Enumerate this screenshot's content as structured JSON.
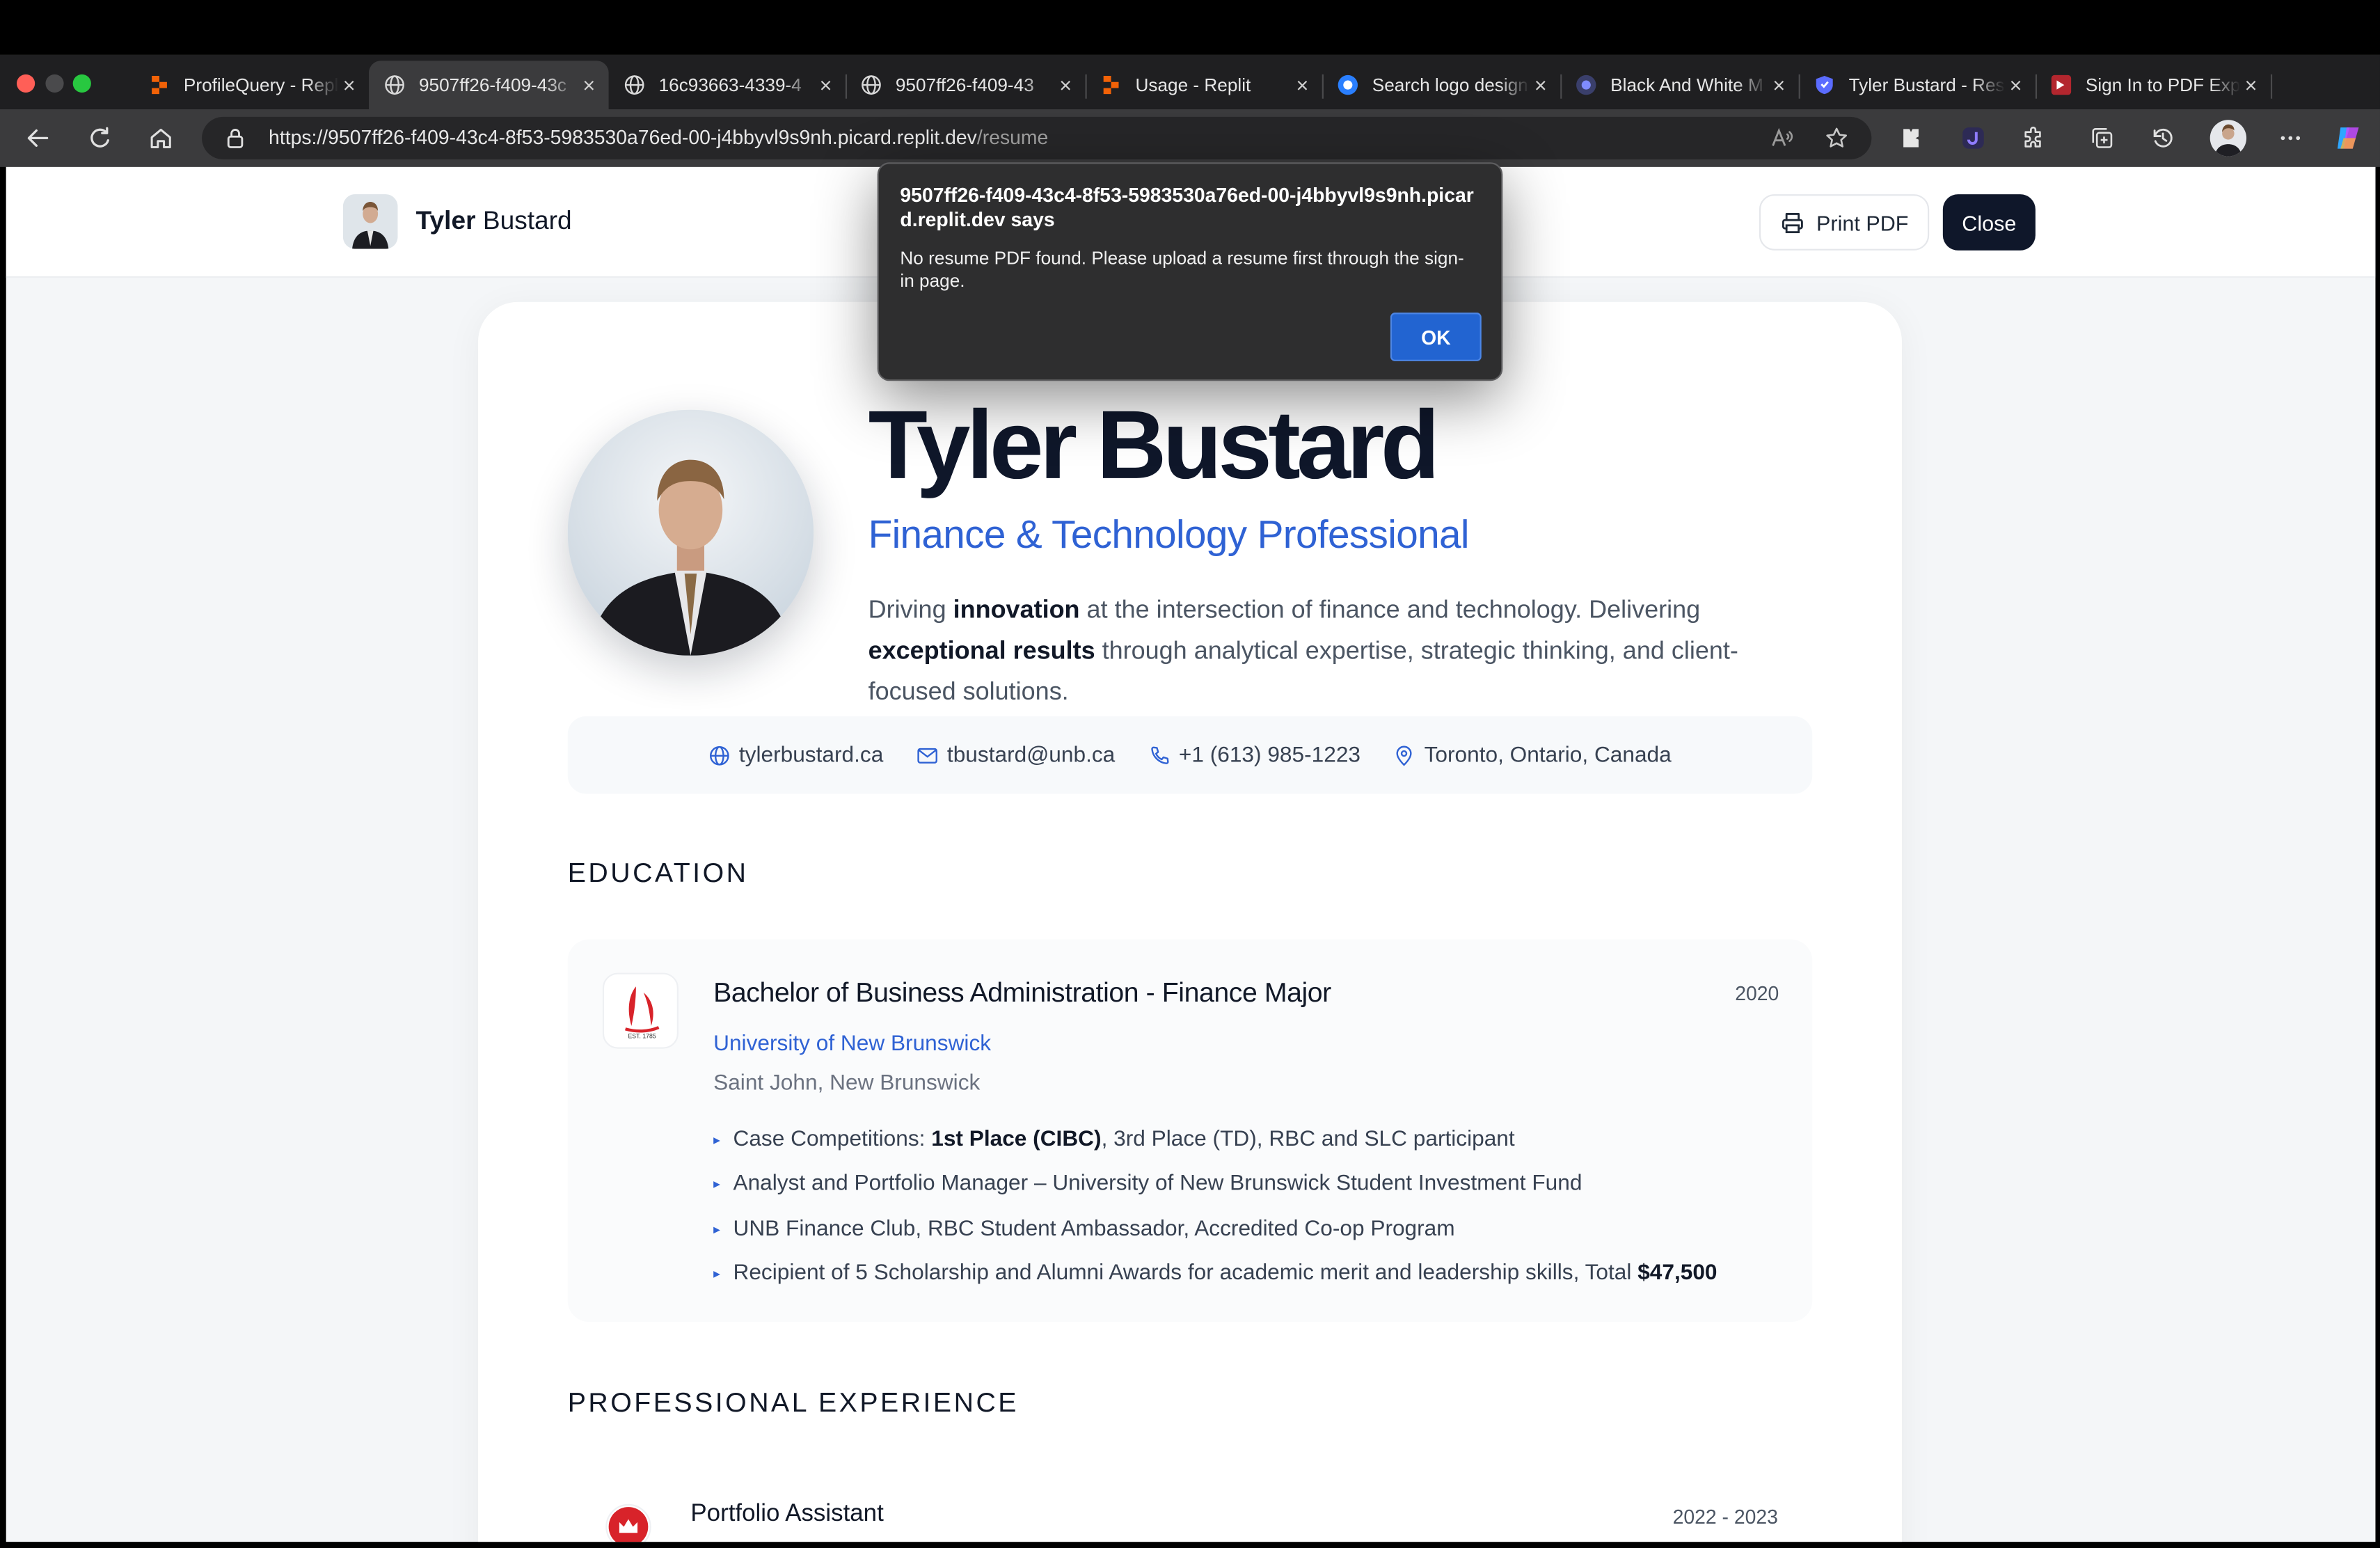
{
  "browser": {
    "tabs": [
      {
        "title": "ProfileQuery - Repl",
        "icon": "replit-icon",
        "active": false
      },
      {
        "title": "9507ff26-f409-43c",
        "icon": "globe-icon",
        "active": true
      },
      {
        "title": "16c93663-4339-4",
        "icon": "globe-icon",
        "active": false
      },
      {
        "title": "9507ff26-f409-43",
        "icon": "globe-icon",
        "active": false
      },
      {
        "title": "Usage - Replit",
        "icon": "replit-icon",
        "active": false
      },
      {
        "title": "Search logo design",
        "icon": "copilot-icon",
        "active": false
      },
      {
        "title": "Black And White M",
        "icon": "copilot-dark-icon",
        "active": false
      },
      {
        "title": "Tyler Bustard - Res",
        "icon": "shield-icon",
        "active": false
      },
      {
        "title": "Sign In to PDF Exp",
        "icon": "pdf-icon",
        "active": false
      }
    ],
    "new_tab": "+",
    "url_host": "https://9507ff26-f409-43c4-8f53-5983530a76ed-00-j4bbyvl9s9nh.picard.replit.dev",
    "url_path": "/resume"
  },
  "header": {
    "first_name": "Tyler",
    "last_name": "Bustard",
    "print_label": "Print PDF",
    "close_label": "Close"
  },
  "profile": {
    "name": "Tyler Bustard",
    "role": "Finance & Technology Professional",
    "summary": [
      {
        "text": "Driving ",
        "bold": false
      },
      {
        "text": "innovation",
        "bold": true
      },
      {
        "text": " at the intersection of finance and technology. Delivering ",
        "bold": false
      },
      {
        "text": "exceptional results",
        "bold": true
      },
      {
        "text": " through analytical expertise, strategic thinking, and client-focused solutions.",
        "bold": false
      }
    ],
    "contact": {
      "website": "tylerbustard.ca",
      "email": "tbustard@unb.ca",
      "phone": "+1 (613) 985-1223",
      "location": "Toronto, Ontario, Canada"
    }
  },
  "education": {
    "section_title": "EDUCATION",
    "degree": "Bachelor of Business Administration - Finance Major",
    "year": "2020",
    "school": "University of New Brunswick",
    "location": "Saint John, New Brunswick",
    "logo_text": "EST. 1785",
    "bullets": [
      [
        {
          "text": "Case Competitions: ",
          "bold": false
        },
        {
          "text": "1st Place (CIBC)",
          "bold": true
        },
        {
          "text": ", 3rd Place (TD), RBC and SLC participant",
          "bold": false
        }
      ],
      [
        {
          "text": "Analyst and Portfolio Manager – University of New Brunswick Student Investment Fund",
          "bold": false
        }
      ],
      [
        {
          "text": "UNB Finance Club, RBC Student Ambassador, Accredited Co-op Program",
          "bold": false
        }
      ],
      [
        {
          "text": "Recipient of 5 Scholarship and Alumni Awards for academic merit and leadership skills, Total ",
          "bold": false
        },
        {
          "text": "$47,500",
          "bold": true
        }
      ]
    ]
  },
  "experience": {
    "section_title": "PROFESSIONAL EXPERIENCE",
    "first_title": "Portfolio Assistant",
    "first_years": "2022 - 2023"
  },
  "dialog": {
    "title": "9507ff26-f409-43c4-8f53-5983530a76ed-00-j4bbyvl9s9nh.picard.replit.dev says",
    "message": "No resume PDF found. Please upload a resume first through the sign-in page.",
    "ok_label": "OK"
  },
  "colors": {
    "accent_blue": "#2f62d4",
    "dark_button": "#0f172a",
    "dialog_ok": "#2264d1"
  }
}
